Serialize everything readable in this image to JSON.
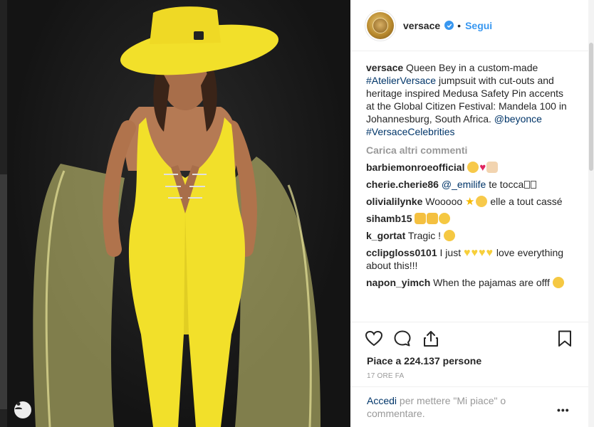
{
  "post": {
    "username": "versace",
    "follow_label": "Segui",
    "separator": "•"
  },
  "caption": {
    "user": "versace",
    "text_1": " Queen Bey in a custom-made ",
    "tag_1": "#AtelierVersace",
    "text_2": " jumpsuit with cut-outs and heritage inspired Medusa Safety Pin accents at the Global Citizen Festival: Mandela 100 in Johannesburg, South Africa. ",
    "mention": "@beyonce",
    "tag_2": "#VersaceCelebrities"
  },
  "load_more_label": "Carica altri commenti",
  "comments": [
    {
      "user": "barbiemonroeofficial",
      "text": ""
    },
    {
      "user": "cherie.cherie86",
      "mention": "@_emilife",
      "text": " te tocca"
    },
    {
      "user": "olivialilynke",
      "text_a": " Wooooo ",
      "text_b": " elle a tout cassé"
    },
    {
      "user": "sihamb15",
      "text": ""
    },
    {
      "user": "k_gortat",
      "text": " Tragic ! "
    },
    {
      "user": "cclipgloss0101",
      "text_a": " I just ",
      "text_b": " love everything about this!!!"
    },
    {
      "user": "napon_yimch",
      "text": " When the pajamas are offf "
    }
  ],
  "likes_label": "Piace a 224.137 persone",
  "time_label": "17 ORE FA",
  "login": {
    "link": "Accedi",
    "text": " per mettere \"Mi piace\" o commentare."
  },
  "more_label": "•••",
  "icons": {
    "verified": "verified-badge-icon",
    "like": "heart-icon",
    "comment": "comment-bubble-icon",
    "share": "share-icon",
    "save": "bookmark-icon",
    "tag": "user-tag-icon"
  },
  "colors": {
    "link": "#3897f0",
    "hashtag": "#003569",
    "muted": "#999999",
    "jumpsuit": "#f2e02a"
  }
}
